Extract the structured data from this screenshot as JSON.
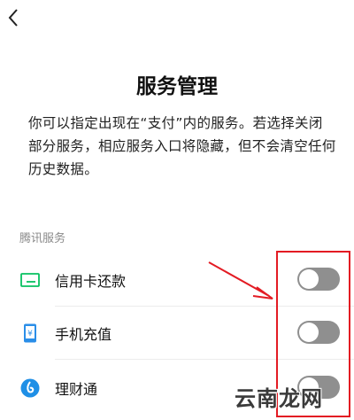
{
  "header": {
    "title": "服务管理"
  },
  "description": "你可以指定出现在“支付”内的服务。若选择关闭部分服务，相应服务入口将隐藏，但不会清空任何历史数据。",
  "section": {
    "label": "腾讯服务"
  },
  "services": [
    {
      "label": "信用卡还款",
      "icon": "credit-card-icon",
      "enabled": false
    },
    {
      "label": "手机充值",
      "icon": "phone-recharge-icon",
      "enabled": false
    },
    {
      "label": "理财通",
      "icon": "wealth-icon",
      "enabled": false
    }
  ],
  "colors": {
    "accent": "#07c160",
    "toggle_off": "#8f8f8f",
    "annotation": "#e31b23"
  },
  "watermark": "云南龙网"
}
